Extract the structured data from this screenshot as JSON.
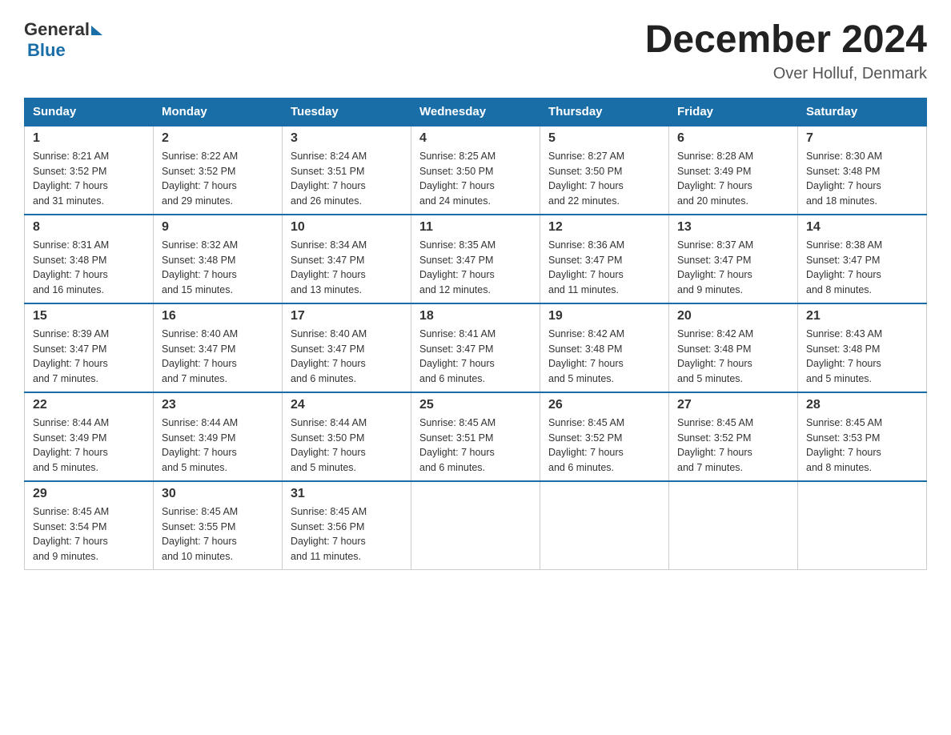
{
  "logo": {
    "general": "General",
    "blue": "Blue"
  },
  "title": "December 2024",
  "subtitle": "Over Holluf, Denmark",
  "days_of_week": [
    "Sunday",
    "Monday",
    "Tuesday",
    "Wednesday",
    "Thursday",
    "Friday",
    "Saturday"
  ],
  "weeks": [
    [
      {
        "day": "1",
        "sunrise": "8:21 AM",
        "sunset": "3:52 PM",
        "daylight": "7 hours and 31 minutes."
      },
      {
        "day": "2",
        "sunrise": "8:22 AM",
        "sunset": "3:52 PM",
        "daylight": "7 hours and 29 minutes."
      },
      {
        "day": "3",
        "sunrise": "8:24 AM",
        "sunset": "3:51 PM",
        "daylight": "7 hours and 26 minutes."
      },
      {
        "day": "4",
        "sunrise": "8:25 AM",
        "sunset": "3:50 PM",
        "daylight": "7 hours and 24 minutes."
      },
      {
        "day": "5",
        "sunrise": "8:27 AM",
        "sunset": "3:50 PM",
        "daylight": "7 hours and 22 minutes."
      },
      {
        "day": "6",
        "sunrise": "8:28 AM",
        "sunset": "3:49 PM",
        "daylight": "7 hours and 20 minutes."
      },
      {
        "day": "7",
        "sunrise": "8:30 AM",
        "sunset": "3:48 PM",
        "daylight": "7 hours and 18 minutes."
      }
    ],
    [
      {
        "day": "8",
        "sunrise": "8:31 AM",
        "sunset": "3:48 PM",
        "daylight": "7 hours and 16 minutes."
      },
      {
        "day": "9",
        "sunrise": "8:32 AM",
        "sunset": "3:48 PM",
        "daylight": "7 hours and 15 minutes."
      },
      {
        "day": "10",
        "sunrise": "8:34 AM",
        "sunset": "3:47 PM",
        "daylight": "7 hours and 13 minutes."
      },
      {
        "day": "11",
        "sunrise": "8:35 AM",
        "sunset": "3:47 PM",
        "daylight": "7 hours and 12 minutes."
      },
      {
        "day": "12",
        "sunrise": "8:36 AM",
        "sunset": "3:47 PM",
        "daylight": "7 hours and 11 minutes."
      },
      {
        "day": "13",
        "sunrise": "8:37 AM",
        "sunset": "3:47 PM",
        "daylight": "7 hours and 9 minutes."
      },
      {
        "day": "14",
        "sunrise": "8:38 AM",
        "sunset": "3:47 PM",
        "daylight": "7 hours and 8 minutes."
      }
    ],
    [
      {
        "day": "15",
        "sunrise": "8:39 AM",
        "sunset": "3:47 PM",
        "daylight": "7 hours and 7 minutes."
      },
      {
        "day": "16",
        "sunrise": "8:40 AM",
        "sunset": "3:47 PM",
        "daylight": "7 hours and 7 minutes."
      },
      {
        "day": "17",
        "sunrise": "8:40 AM",
        "sunset": "3:47 PM",
        "daylight": "7 hours and 6 minutes."
      },
      {
        "day": "18",
        "sunrise": "8:41 AM",
        "sunset": "3:47 PM",
        "daylight": "7 hours and 6 minutes."
      },
      {
        "day": "19",
        "sunrise": "8:42 AM",
        "sunset": "3:48 PM",
        "daylight": "7 hours and 5 minutes."
      },
      {
        "day": "20",
        "sunrise": "8:42 AM",
        "sunset": "3:48 PM",
        "daylight": "7 hours and 5 minutes."
      },
      {
        "day": "21",
        "sunrise": "8:43 AM",
        "sunset": "3:48 PM",
        "daylight": "7 hours and 5 minutes."
      }
    ],
    [
      {
        "day": "22",
        "sunrise": "8:44 AM",
        "sunset": "3:49 PM",
        "daylight": "7 hours and 5 minutes."
      },
      {
        "day": "23",
        "sunrise": "8:44 AM",
        "sunset": "3:49 PM",
        "daylight": "7 hours and 5 minutes."
      },
      {
        "day": "24",
        "sunrise": "8:44 AM",
        "sunset": "3:50 PM",
        "daylight": "7 hours and 5 minutes."
      },
      {
        "day": "25",
        "sunrise": "8:45 AM",
        "sunset": "3:51 PM",
        "daylight": "7 hours and 6 minutes."
      },
      {
        "day": "26",
        "sunrise": "8:45 AM",
        "sunset": "3:52 PM",
        "daylight": "7 hours and 6 minutes."
      },
      {
        "day": "27",
        "sunrise": "8:45 AM",
        "sunset": "3:52 PM",
        "daylight": "7 hours and 7 minutes."
      },
      {
        "day": "28",
        "sunrise": "8:45 AM",
        "sunset": "3:53 PM",
        "daylight": "7 hours and 8 minutes."
      }
    ],
    [
      {
        "day": "29",
        "sunrise": "8:45 AM",
        "sunset": "3:54 PM",
        "daylight": "7 hours and 9 minutes."
      },
      {
        "day": "30",
        "sunrise": "8:45 AM",
        "sunset": "3:55 PM",
        "daylight": "7 hours and 10 minutes."
      },
      {
        "day": "31",
        "sunrise": "8:45 AM",
        "sunset": "3:56 PM",
        "daylight": "7 hours and 11 minutes."
      },
      null,
      null,
      null,
      null
    ]
  ],
  "labels": {
    "sunrise": "Sunrise:",
    "sunset": "Sunset:",
    "daylight": "Daylight:"
  }
}
